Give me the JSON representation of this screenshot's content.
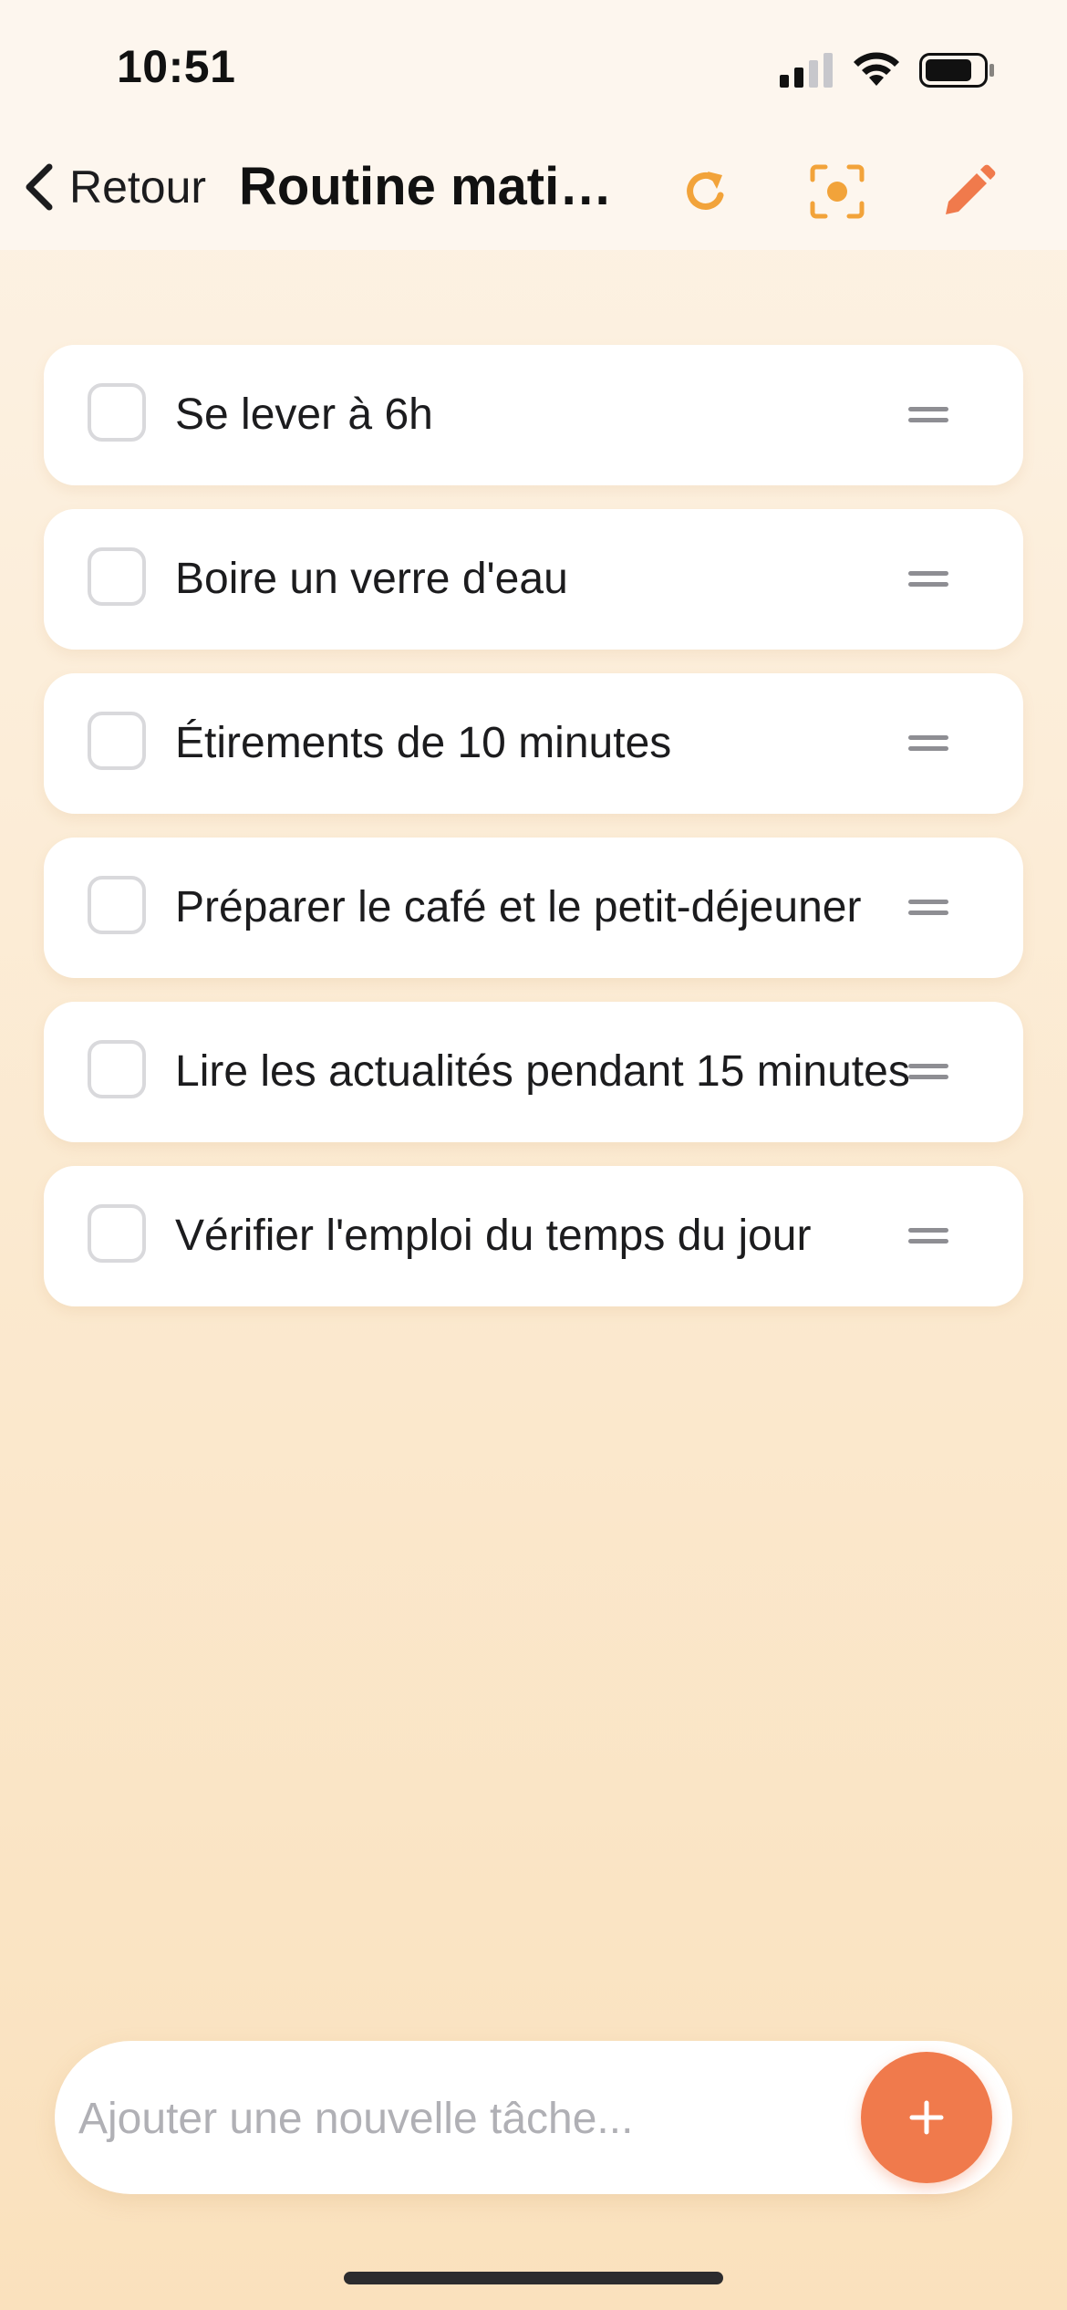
{
  "status_bar": {
    "time": "10:51",
    "icons": [
      "signal-icon",
      "wifi-icon",
      "battery-icon"
    ]
  },
  "nav": {
    "back_label": "Retour",
    "title": "Routine matinale",
    "actions": [
      "refresh-icon",
      "focus-icon",
      "pencil-icon"
    ]
  },
  "tasks": [
    {
      "label": "Se lever à 6h",
      "checked": false
    },
    {
      "label": "Boire un verre d'eau",
      "checked": false
    },
    {
      "label": "Étirements de 10 minutes",
      "checked": false
    },
    {
      "label": "Préparer le café et le petit-déjeuner",
      "checked": false
    },
    {
      "label": "Lire les actualités pendant 15 minutes",
      "checked": false
    },
    {
      "label": "Vérifier l'emploi du temps du jour",
      "checked": false
    }
  ],
  "add_task": {
    "placeholder": "Ajouter une nouvelle tâche...",
    "value": "",
    "button_icon": "plus-icon"
  },
  "colors": {
    "accent_orange": "#f07a4c",
    "refresh_orange": "#f2a33a",
    "background_top": "#fdf3e6",
    "background_bottom": "#fae1bd",
    "card": "#ffffff"
  }
}
